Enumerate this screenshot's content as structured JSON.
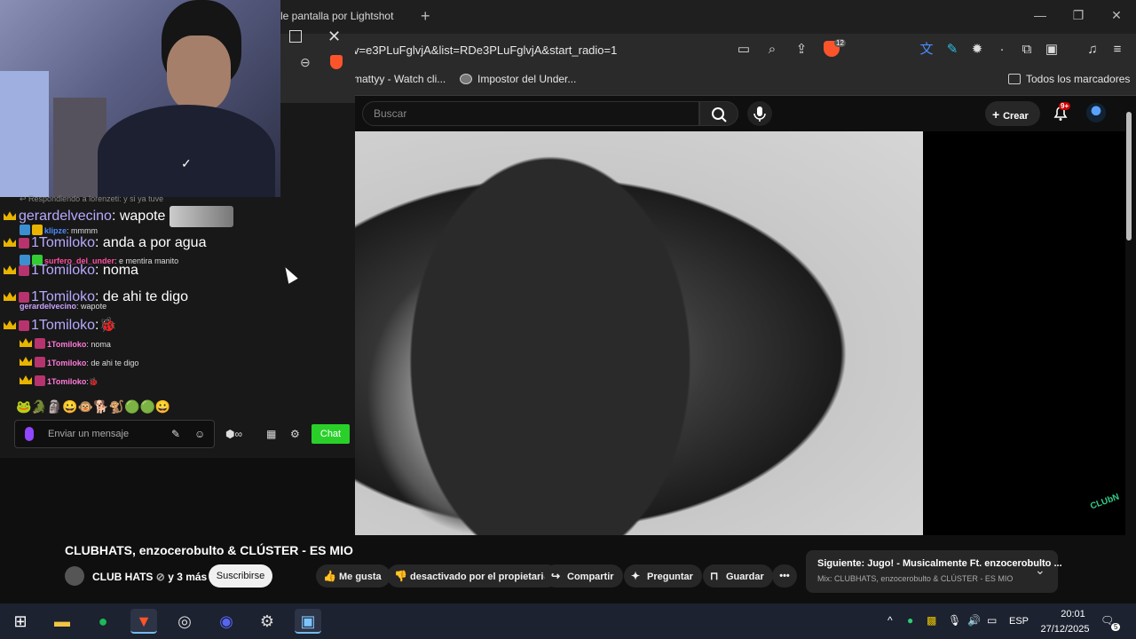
{
  "browser": {
    "tab_title": "le pantalla por Lightshot",
    "url": "v=e3PLuFglvjA&list=RDe3PLuFglvjA&start_radio=1",
    "brave_shield_count": "12",
    "bookmarks": [
      "mattyy - Watch cli...",
      "Impostor del Under..."
    ],
    "all_bookmarks": "Todos los marcadores"
  },
  "youtube": {
    "search_placeholder": "Buscar",
    "create_label": "Crear",
    "notification_count": "9+",
    "video_title": "CLUBHATS, enzocerobulto & CLÚSTER - ES MIO",
    "channel_name": "CLUB HATS",
    "channel_extra": "y 3 más",
    "subscribe_label": "Suscribirse",
    "actions": {
      "like": "Me gusta",
      "dislike": "desactivado por el propietario",
      "share": "Compartir",
      "ask": "Preguntar",
      "save": "Guardar"
    },
    "next": {
      "title": "Siguiente: Jugo! - Musicalmente Ft. enzocerobulto ...",
      "subtitle": "Mix: CLUBHATS, enzocerobulto & CLÚSTER - ES MIO"
    },
    "corner_logo": "CLUbN"
  },
  "chat": {
    "reply_header": "Respondiendo a lorenzeti: y si ya tuve",
    "big_messages": [
      {
        "user": "gerardelvecino",
        "text": " wapote"
      },
      {
        "user": "1Tomiloko",
        "text": " anda a por agua"
      },
      {
        "user": "1Tomiloko",
        "text": " noma"
      },
      {
        "user": "1Tomiloko",
        "text": " de ahi te digo"
      },
      {
        "user": "1Tomiloko",
        "text": ""
      }
    ],
    "small_messages": [
      {
        "user": "klipze",
        "text": " mmmm"
      },
      {
        "user": "surfero_del_under",
        "text": " e mentira manito"
      },
      {
        "user": "gerardelvecino",
        "text": " wapote"
      },
      {
        "user": "1Tomiloko",
        "text": " noma"
      },
      {
        "user": "1Tomiloko",
        "text": " de ahi te digo"
      },
      {
        "user": "1Tomiloko",
        "text": ""
      }
    ],
    "emotes": "🐸🐊🗿😀🐵🐕🐒🟢🟢😀",
    "input_placeholder": "Enviar un mensaje",
    "chat_button": "Chat"
  },
  "taskbar": {
    "language": "ESP",
    "time": "20:01",
    "date": "27/12/2025",
    "notification_count": "5"
  },
  "colors": {
    "youtube_bg": "#0f0f0f",
    "chat_green": "#2ad02a",
    "brave_orange": "#fb542b",
    "taskbar": "#1c2230"
  }
}
